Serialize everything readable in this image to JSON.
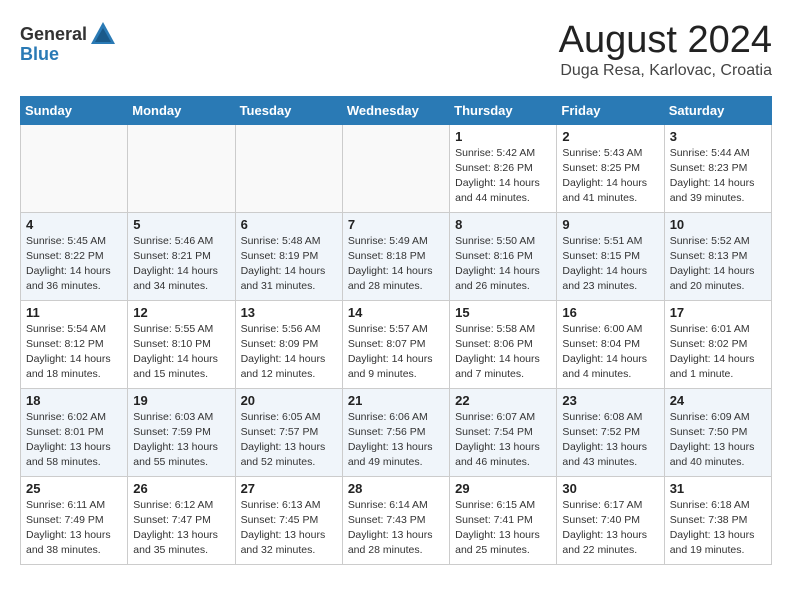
{
  "header": {
    "logo_general": "General",
    "logo_blue": "Blue",
    "month_title": "August 2024",
    "location": "Duga Resa, Karlovac, Croatia"
  },
  "days_of_week": [
    "Sunday",
    "Monday",
    "Tuesday",
    "Wednesday",
    "Thursday",
    "Friday",
    "Saturday"
  ],
  "weeks": [
    [
      {
        "day": "",
        "info": ""
      },
      {
        "day": "",
        "info": ""
      },
      {
        "day": "",
        "info": ""
      },
      {
        "day": "",
        "info": ""
      },
      {
        "day": "1",
        "info": "Sunrise: 5:42 AM\nSunset: 8:26 PM\nDaylight: 14 hours\nand 44 minutes."
      },
      {
        "day": "2",
        "info": "Sunrise: 5:43 AM\nSunset: 8:25 PM\nDaylight: 14 hours\nand 41 minutes."
      },
      {
        "day": "3",
        "info": "Sunrise: 5:44 AM\nSunset: 8:23 PM\nDaylight: 14 hours\nand 39 minutes."
      }
    ],
    [
      {
        "day": "4",
        "info": "Sunrise: 5:45 AM\nSunset: 8:22 PM\nDaylight: 14 hours\nand 36 minutes."
      },
      {
        "day": "5",
        "info": "Sunrise: 5:46 AM\nSunset: 8:21 PM\nDaylight: 14 hours\nand 34 minutes."
      },
      {
        "day": "6",
        "info": "Sunrise: 5:48 AM\nSunset: 8:19 PM\nDaylight: 14 hours\nand 31 minutes."
      },
      {
        "day": "7",
        "info": "Sunrise: 5:49 AM\nSunset: 8:18 PM\nDaylight: 14 hours\nand 28 minutes."
      },
      {
        "day": "8",
        "info": "Sunrise: 5:50 AM\nSunset: 8:16 PM\nDaylight: 14 hours\nand 26 minutes."
      },
      {
        "day": "9",
        "info": "Sunrise: 5:51 AM\nSunset: 8:15 PM\nDaylight: 14 hours\nand 23 minutes."
      },
      {
        "day": "10",
        "info": "Sunrise: 5:52 AM\nSunset: 8:13 PM\nDaylight: 14 hours\nand 20 minutes."
      }
    ],
    [
      {
        "day": "11",
        "info": "Sunrise: 5:54 AM\nSunset: 8:12 PM\nDaylight: 14 hours\nand 18 minutes."
      },
      {
        "day": "12",
        "info": "Sunrise: 5:55 AM\nSunset: 8:10 PM\nDaylight: 14 hours\nand 15 minutes."
      },
      {
        "day": "13",
        "info": "Sunrise: 5:56 AM\nSunset: 8:09 PM\nDaylight: 14 hours\nand 12 minutes."
      },
      {
        "day": "14",
        "info": "Sunrise: 5:57 AM\nSunset: 8:07 PM\nDaylight: 14 hours\nand 9 minutes."
      },
      {
        "day": "15",
        "info": "Sunrise: 5:58 AM\nSunset: 8:06 PM\nDaylight: 14 hours\nand 7 minutes."
      },
      {
        "day": "16",
        "info": "Sunrise: 6:00 AM\nSunset: 8:04 PM\nDaylight: 14 hours\nand 4 minutes."
      },
      {
        "day": "17",
        "info": "Sunrise: 6:01 AM\nSunset: 8:02 PM\nDaylight: 14 hours\nand 1 minute."
      }
    ],
    [
      {
        "day": "18",
        "info": "Sunrise: 6:02 AM\nSunset: 8:01 PM\nDaylight: 13 hours\nand 58 minutes."
      },
      {
        "day": "19",
        "info": "Sunrise: 6:03 AM\nSunset: 7:59 PM\nDaylight: 13 hours\nand 55 minutes."
      },
      {
        "day": "20",
        "info": "Sunrise: 6:05 AM\nSunset: 7:57 PM\nDaylight: 13 hours\nand 52 minutes."
      },
      {
        "day": "21",
        "info": "Sunrise: 6:06 AM\nSunset: 7:56 PM\nDaylight: 13 hours\nand 49 minutes."
      },
      {
        "day": "22",
        "info": "Sunrise: 6:07 AM\nSunset: 7:54 PM\nDaylight: 13 hours\nand 46 minutes."
      },
      {
        "day": "23",
        "info": "Sunrise: 6:08 AM\nSunset: 7:52 PM\nDaylight: 13 hours\nand 43 minutes."
      },
      {
        "day": "24",
        "info": "Sunrise: 6:09 AM\nSunset: 7:50 PM\nDaylight: 13 hours\nand 40 minutes."
      }
    ],
    [
      {
        "day": "25",
        "info": "Sunrise: 6:11 AM\nSunset: 7:49 PM\nDaylight: 13 hours\nand 38 minutes."
      },
      {
        "day": "26",
        "info": "Sunrise: 6:12 AM\nSunset: 7:47 PM\nDaylight: 13 hours\nand 35 minutes."
      },
      {
        "day": "27",
        "info": "Sunrise: 6:13 AM\nSunset: 7:45 PM\nDaylight: 13 hours\nand 32 minutes."
      },
      {
        "day": "28",
        "info": "Sunrise: 6:14 AM\nSunset: 7:43 PM\nDaylight: 13 hours\nand 28 minutes."
      },
      {
        "day": "29",
        "info": "Sunrise: 6:15 AM\nSunset: 7:41 PM\nDaylight: 13 hours\nand 25 minutes."
      },
      {
        "day": "30",
        "info": "Sunrise: 6:17 AM\nSunset: 7:40 PM\nDaylight: 13 hours\nand 22 minutes."
      },
      {
        "day": "31",
        "info": "Sunrise: 6:18 AM\nSunset: 7:38 PM\nDaylight: 13 hours\nand 19 minutes."
      }
    ]
  ]
}
